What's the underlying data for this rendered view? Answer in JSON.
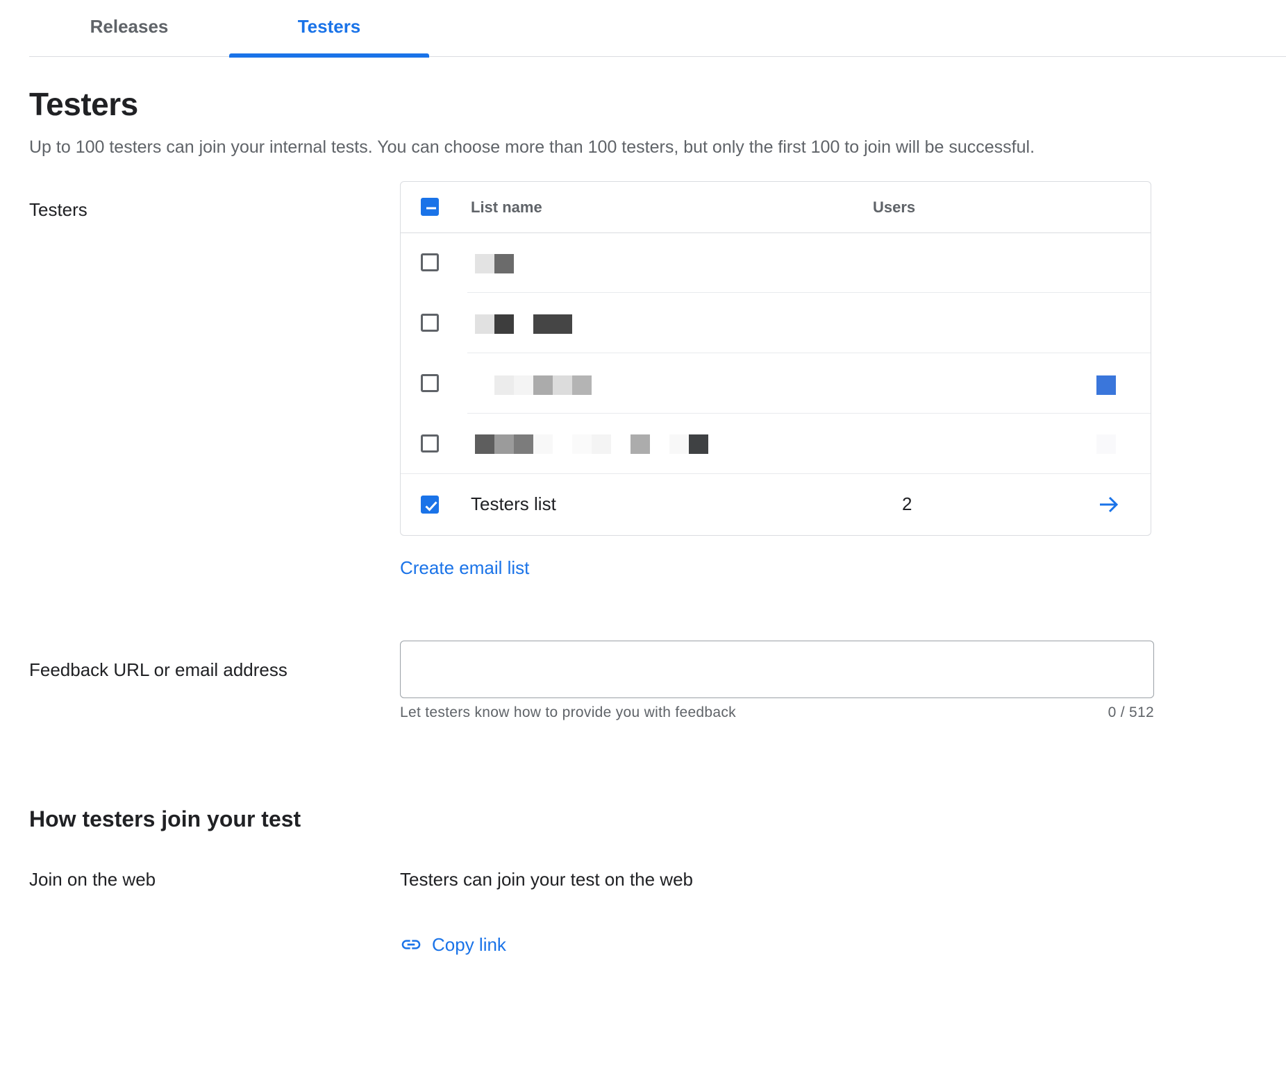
{
  "tabs": [
    {
      "label": "Releases",
      "active": false
    },
    {
      "label": "Testers",
      "active": true
    }
  ],
  "page": {
    "title": "Testers",
    "description": "Up to 100 testers can join your internal tests. You can choose more than 100 testers, but only the first 100 to join will be successful."
  },
  "testers_field": {
    "label": "Testers",
    "table": {
      "header": {
        "list_name": "List name",
        "users": "Users",
        "select_all_state": "indeterminate"
      },
      "rows": [
        {
          "name": "",
          "redacted": true,
          "checked": false
        },
        {
          "name": "",
          "redacted": true,
          "checked": false
        },
        {
          "name": "",
          "redacted": true,
          "checked": false
        },
        {
          "name": "",
          "redacted": true,
          "checked": false
        },
        {
          "name": "Testers list",
          "users": "2",
          "checked": true
        }
      ]
    },
    "create_link": "Create email list"
  },
  "feedback": {
    "label": "Feedback URL or email address",
    "value": "",
    "helper": "Let testers know how to provide you with feedback",
    "counter": "0 / 512"
  },
  "join": {
    "section_title": "How testers join your test",
    "label": "Join on the web",
    "text": "Testers can join your test on the web",
    "copy_link": "Copy link"
  },
  "colors": {
    "accent": "#1a73e8",
    "text": "#202124",
    "secondary_text": "#5f6368",
    "divider": "#dadce0"
  },
  "icons": [
    "checkbox-indeterminate-icon",
    "checkbox-icon",
    "checkmark-icon",
    "arrow-right-icon",
    "link-icon"
  ]
}
